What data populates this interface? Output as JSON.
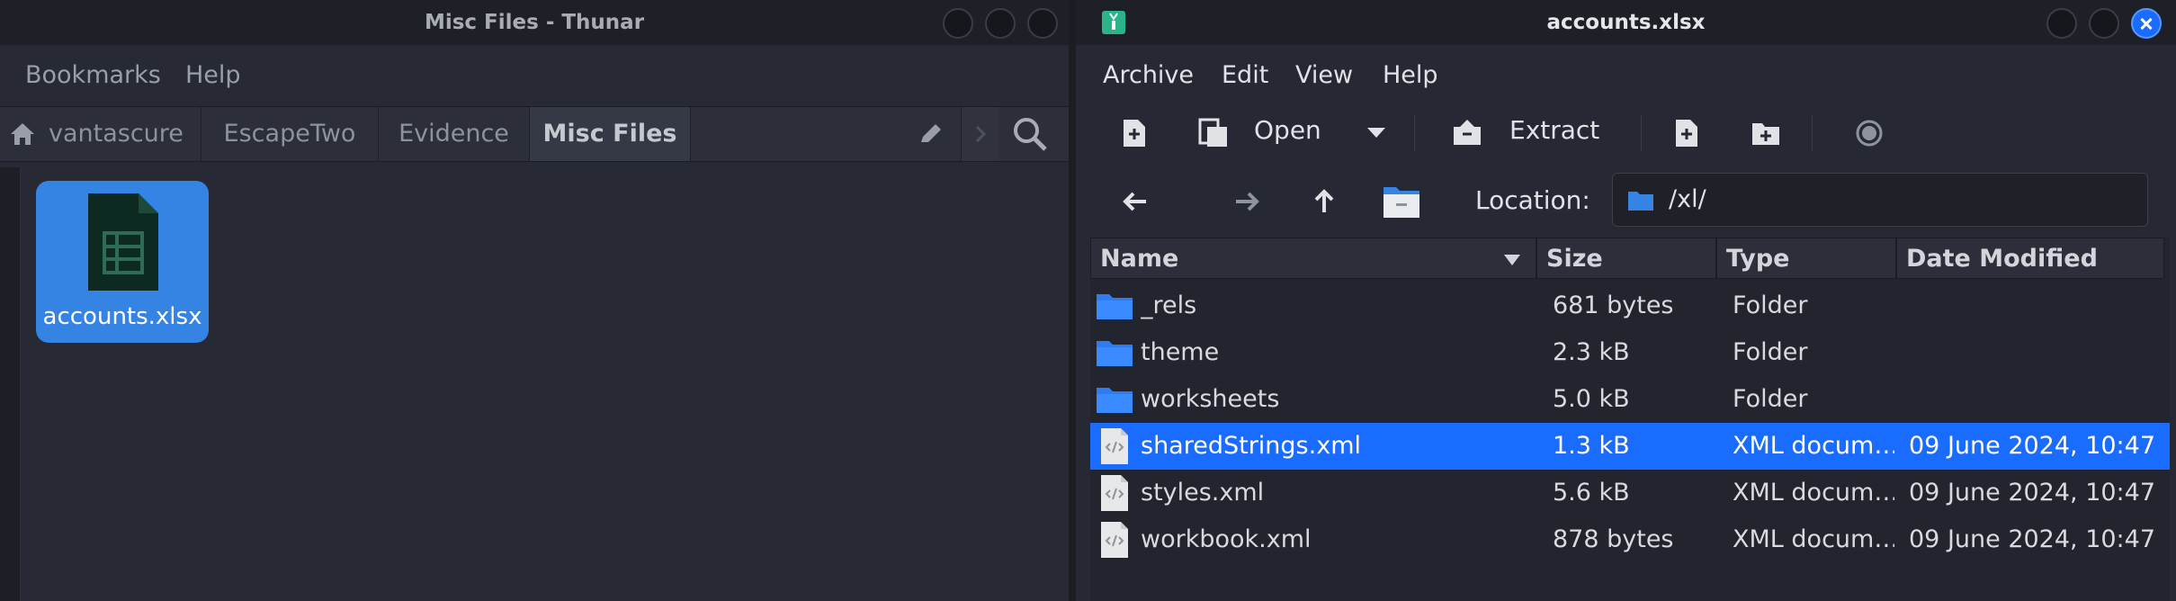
{
  "left": {
    "title": "Misc Files - Thunar",
    "menu": [
      "Bookmarks",
      "Help"
    ],
    "breadcrumbs": [
      "vantascure",
      "EscapeTwo",
      "Evidence",
      "Misc Files"
    ],
    "file": {
      "name": "accounts.xlsx",
      "icon": "spreadsheet-icon"
    }
  },
  "right": {
    "title": "accounts.xlsx",
    "menu": [
      "Archive",
      "Edit",
      "View",
      "Help"
    ],
    "toolbar": {
      "open": "Open",
      "extract": "Extract"
    },
    "location": {
      "label": "Location:",
      "path": "/xl/"
    },
    "columns": [
      "Name",
      "Size",
      "Type",
      "Date Modified"
    ],
    "rows": [
      {
        "name": "_rels",
        "size": "681 bytes",
        "type": "Folder",
        "date": "",
        "icon": "folder-icon"
      },
      {
        "name": "theme",
        "size": "2.3 kB",
        "type": "Folder",
        "date": "",
        "icon": "folder-icon"
      },
      {
        "name": "worksheets",
        "size": "5.0 kB",
        "type": "Folder",
        "date": "",
        "icon": "folder-icon"
      },
      {
        "name": "sharedStrings.xml",
        "size": "1.3 kB",
        "type": "XML docum…",
        "date": "09 June 2024, 10:47",
        "icon": "xml-file-icon",
        "selected": true
      },
      {
        "name": "styles.xml",
        "size": "5.6 kB",
        "type": "XML docum…",
        "date": "09 June 2024, 10:47",
        "icon": "xml-file-icon"
      },
      {
        "name": "workbook.xml",
        "size": "878 bytes",
        "type": "XML docum…",
        "date": "09 June 2024, 10:47",
        "icon": "xml-file-icon"
      }
    ]
  },
  "colors": {
    "accent": "#1a6cff",
    "selection": "#3584e4"
  }
}
